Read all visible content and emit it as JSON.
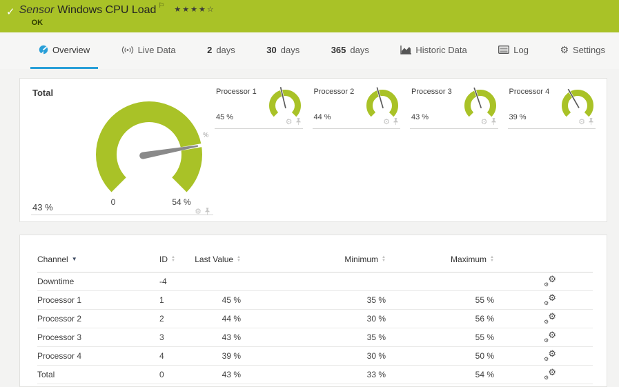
{
  "header": {
    "kind": "Sensor",
    "title": "Windows CPU Load",
    "status": "OK",
    "stars": "★★★★☆"
  },
  "icons": {
    "check": "✓",
    "flag": "⚐",
    "gear": "⚙",
    "sort_asc": "▲",
    "sort_desc": "▼"
  },
  "tabs": [
    {
      "label": "Overview",
      "active": true
    },
    {
      "label": "Live Data"
    },
    {
      "num": "2",
      "word": "days"
    },
    {
      "num": "30",
      "word": "days"
    },
    {
      "num": "365",
      "word": "days"
    },
    {
      "label": "Historic Data"
    },
    {
      "label": "Log"
    },
    {
      "label": "Settings"
    }
  ],
  "gauge_total": {
    "label": "Total",
    "value": 43,
    "min": 0,
    "max": 54,
    "value_label": "43 %",
    "scale_min_label": "0",
    "scale_max_label": "54 %",
    "unit_label": "%"
  },
  "gauges_small": [
    {
      "label": "Processor 1",
      "value": 45,
      "min": 0,
      "max": 100,
      "value_label": "45 %"
    },
    {
      "label": "Processor 2",
      "value": 44,
      "min": 0,
      "max": 100,
      "value_label": "44 %"
    },
    {
      "label": "Processor 3",
      "value": 43,
      "min": 0,
      "max": 100,
      "value_label": "43 %"
    },
    {
      "label": "Processor 4",
      "value": 39,
      "min": 0,
      "max": 100,
      "value_label": "39 %"
    }
  ],
  "channel_table": {
    "headers": {
      "channel": "Channel",
      "id": "ID",
      "last": "Last Value",
      "min": "Minimum",
      "max": "Maximum"
    },
    "rows": [
      {
        "channel": "Downtime",
        "id": "-4",
        "last": "",
        "min": "",
        "max": ""
      },
      {
        "channel": "Processor 1",
        "id": "1",
        "last": "45 %",
        "min": "35 %",
        "max": "55 %"
      },
      {
        "channel": "Processor 2",
        "id": "2",
        "last": "44 %",
        "min": "30 %",
        "max": "56 %"
      },
      {
        "channel": "Processor 3",
        "id": "3",
        "last": "43 %",
        "min": "35 %",
        "max": "55 %"
      },
      {
        "channel": "Processor 4",
        "id": "4",
        "last": "39 %",
        "min": "30 %",
        "max": "50 %"
      },
      {
        "channel": "Total",
        "id": "0",
        "last": "43 %",
        "min": "33 %",
        "max": "54 %"
      }
    ]
  },
  "colors": {
    "green": "#a9c227",
    "accent_blue": "#299fd8",
    "needle": "#8a8a8a"
  }
}
